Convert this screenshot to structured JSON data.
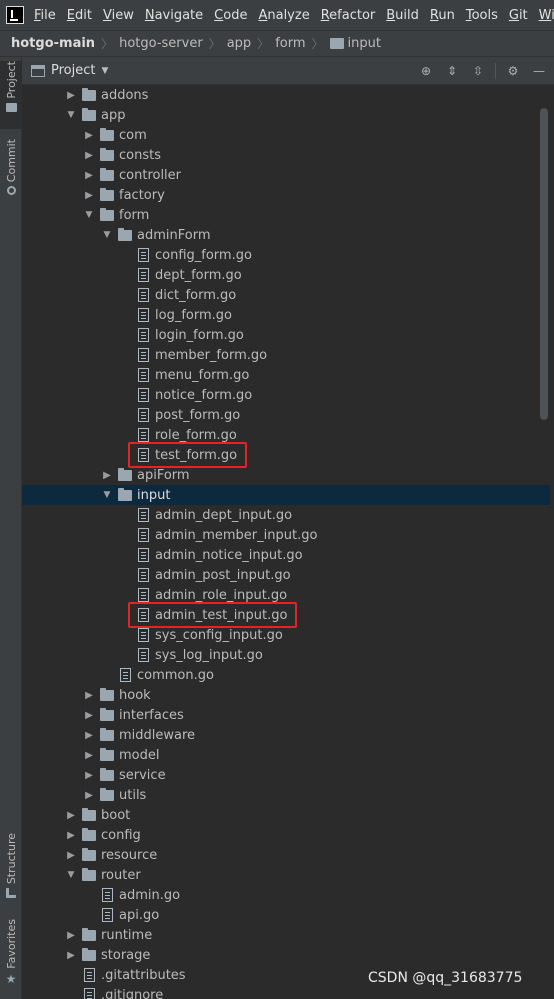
{
  "menu": [
    "File",
    "Edit",
    "View",
    "Navigate",
    "Code",
    "Analyze",
    "Refactor",
    "Build",
    "Run",
    "Tools",
    "Git",
    "Window"
  ],
  "breadcrumb": [
    "hotgo-main",
    "hotgo-server",
    "app",
    "form",
    "input"
  ],
  "toolstrip": {
    "project": "Project",
    "commit": "Commit",
    "structure": "Structure",
    "favorites": "Favorites"
  },
  "tool_window": {
    "title": "Project"
  },
  "tree": [
    {
      "name": "addons",
      "type": "folder",
      "level": 0,
      "expanded": false
    },
    {
      "name": "app",
      "type": "folder",
      "level": 0,
      "expanded": true
    },
    {
      "name": "com",
      "type": "folder",
      "level": 1,
      "expanded": false
    },
    {
      "name": "consts",
      "type": "folder",
      "level": 1,
      "expanded": false
    },
    {
      "name": "controller",
      "type": "folder",
      "level": 1,
      "expanded": false
    },
    {
      "name": "factory",
      "type": "folder",
      "level": 1,
      "expanded": false
    },
    {
      "name": "form",
      "type": "folder",
      "level": 1,
      "expanded": true
    },
    {
      "name": "adminForm",
      "type": "folder",
      "level": 2,
      "expanded": true
    },
    {
      "name": "config_form.go",
      "type": "file",
      "level": 3
    },
    {
      "name": "dept_form.go",
      "type": "file",
      "level": 3
    },
    {
      "name": "dict_form.go",
      "type": "file",
      "level": 3
    },
    {
      "name": "log_form.go",
      "type": "file",
      "level": 3
    },
    {
      "name": "login_form.go",
      "type": "file",
      "level": 3
    },
    {
      "name": "member_form.go",
      "type": "file",
      "level": 3
    },
    {
      "name": "menu_form.go",
      "type": "file",
      "level": 3
    },
    {
      "name": "notice_form.go",
      "type": "file",
      "level": 3
    },
    {
      "name": "post_form.go",
      "type": "file",
      "level": 3
    },
    {
      "name": "role_form.go",
      "type": "file",
      "level": 3
    },
    {
      "name": "test_form.go",
      "type": "file",
      "level": 3,
      "highlighted": true
    },
    {
      "name": "apiForm",
      "type": "folder",
      "level": 2,
      "expanded": false
    },
    {
      "name": "input",
      "type": "folder",
      "level": 2,
      "expanded": true,
      "selected": true
    },
    {
      "name": "admin_dept_input.go",
      "type": "file",
      "level": 3
    },
    {
      "name": "admin_member_input.go",
      "type": "file",
      "level": 3
    },
    {
      "name": "admin_notice_input.go",
      "type": "file",
      "level": 3
    },
    {
      "name": "admin_post_input.go",
      "type": "file",
      "level": 3
    },
    {
      "name": "admin_role_input.go",
      "type": "file",
      "level": 3
    },
    {
      "name": "admin_test_input.go",
      "type": "file",
      "level": 3,
      "highlighted": true
    },
    {
      "name": "sys_config_input.go",
      "type": "file",
      "level": 3
    },
    {
      "name": "sys_log_input.go",
      "type": "file",
      "level": 3
    },
    {
      "name": "common.go",
      "type": "file",
      "level": 2
    },
    {
      "name": "hook",
      "type": "folder",
      "level": 1,
      "expanded": false
    },
    {
      "name": "interfaces",
      "type": "folder",
      "level": 1,
      "expanded": false
    },
    {
      "name": "middleware",
      "type": "folder",
      "level": 1,
      "expanded": false
    },
    {
      "name": "model",
      "type": "folder",
      "level": 1,
      "expanded": false
    },
    {
      "name": "service",
      "type": "folder",
      "level": 1,
      "expanded": false
    },
    {
      "name": "utils",
      "type": "folder",
      "level": 1,
      "expanded": false
    },
    {
      "name": "boot",
      "type": "folder",
      "level": 0,
      "expanded": false
    },
    {
      "name": "config",
      "type": "folder",
      "level": 0,
      "expanded": false
    },
    {
      "name": "resource",
      "type": "folder",
      "level": 0,
      "expanded": false
    },
    {
      "name": "router",
      "type": "folder",
      "level": 0,
      "expanded": true
    },
    {
      "name": "admin.go",
      "type": "file",
      "level": 1
    },
    {
      "name": "api.go",
      "type": "file",
      "level": 1
    },
    {
      "name": "runtime",
      "type": "folder",
      "level": 0,
      "expanded": false
    },
    {
      "name": "storage",
      "type": "folder",
      "level": 0,
      "expanded": false
    },
    {
      "name": ".gitattributes",
      "type": "file",
      "level": 0
    },
    {
      "name": ".gitignore",
      "type": "file",
      "level": 0
    }
  ],
  "watermark": "CSDN @qq_31683775",
  "colors": {
    "highlight_box": "#e0242b",
    "selection": "#0d293e",
    "background": "#2b2b2b"
  }
}
